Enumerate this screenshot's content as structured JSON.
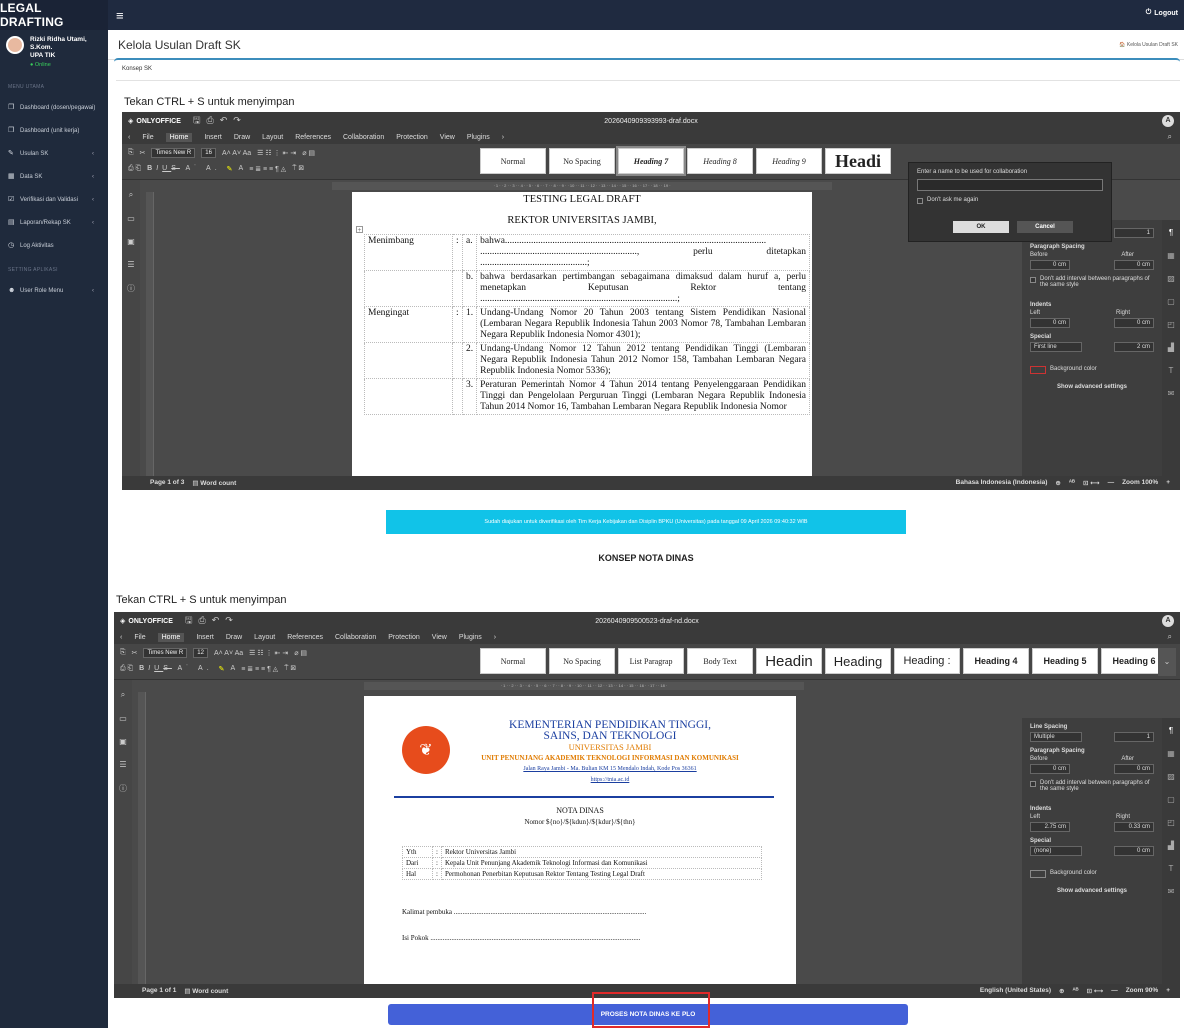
{
  "app": {
    "brand": "LEGAL DRAFTING",
    "logout": "Logout"
  },
  "user": {
    "name": "Rizki Ridha Utami, S.Kom.",
    "unit": "UPA TIK",
    "status": "Online"
  },
  "sidebar": {
    "menu_head": "MENU UTAMA",
    "settings_head": "SETTING APLIKASI",
    "items": [
      {
        "label": "Dashboard (dosen/pegawai)"
      },
      {
        "label": "Dashboard (unit kerja)"
      },
      {
        "label": "Usulan SK"
      },
      {
        "label": "Data SK"
      },
      {
        "label": "Verifikasi dan Validasi"
      },
      {
        "label": "Laporan/Rekap SK"
      },
      {
        "label": "Log Aktivitas"
      },
      {
        "label": "User Role Menu"
      }
    ]
  },
  "header": {
    "title": "Kelola Usulan Draft SK",
    "breadcrumb": "Kelola Usulan Draft SK",
    "tab": "Konsep SK"
  },
  "save_hint": "Tekan CTRL + S untuk menyimpan",
  "editor_common": {
    "brand": "ONLYOFFICE",
    "menus": [
      "File",
      "Home",
      "Insert",
      "Draw",
      "Layout",
      "References",
      "Collaboration",
      "Protection",
      "View",
      "Plugins"
    ],
    "font": "Times New R",
    "word_count": "Word count",
    "bg_color": "Background color",
    "advanced": "Show advanced settings",
    "para_spacing": "Paragraph Spacing",
    "before": "Before",
    "after": "After",
    "dont_add": "Don't add interval between paragraphs of the same style",
    "indents": "Indents",
    "left": "Left",
    "right": "Right",
    "special": "Special"
  },
  "editor1": {
    "filename": "2026040909393993-draf.docx",
    "font_size": "16",
    "styles": [
      "Normal",
      "No Spacing",
      "Heading 7",
      "Heading 8",
      "Heading 9",
      "Headi"
    ],
    "page_info": "Page 1 of 3",
    "language": "Bahasa Indonesia (Indonesia)",
    "zoom": "Zoom 100%",
    "spacing_before": "0 cm",
    "spacing_after": "0 cm",
    "indent_left": "0 cm",
    "indent_right": "0 cm",
    "special_val": "First line",
    "special_num": "2 cm",
    "line_val": "1",
    "doc": {
      "title": "TESTING LEGAL DRAFT",
      "subtitle": "REKTOR UNIVERSITAS JAMBI,",
      "menimbang": "Menimbang",
      "mengingat": "Mengingat",
      "a": "a.",
      "b": "b.",
      "n1": "1.",
      "n2": "2.",
      "n3": "3.",
      "colon": ":",
      "a_text": "bahwa.............................................................................................................. .................................................................., perlu ditetapkan .............................................;",
      "b_text": "bahwa berdasarkan pertimbangan sebagaimana dimaksud dalam huruf a, perlu menetapkan Keputusan Rektor tentang ...................................................................................;",
      "m1": "Undang-Undang Nomor 20 Tahun 2003 tentang Sistem Pendidikan Nasional (Lembaran Negara Republik Indonesia Tahun 2003 Nomor 78, Tambahan Lembaran Negara Republik Indonesia Nomor 4301);",
      "m2": "Undang-Undang Nomor 12 Tahun 2012 tentang Pendidikan Tinggi (Lembaran Negara Republik Indonesia Tahun 2012 Nomor 158, Tambahan Lembaran Negara Republik Indonesia Nomor 5336);",
      "m3": "Peraturan Pemerintah Nomor 4 Tahun 2014 tentang Penyelenggaraan Pendidikan Tinggi dan Pengelolaan Perguruan Tinggi (Lembaran Negara Republik Indonesia Tahun 2014 Nomor 16, Tambahan Lembaran Negara Republik Indonesia Nomor"
    },
    "dialog": {
      "prompt": "Enter a name to be used for collaboration",
      "dont_ask": "Don't ask me again",
      "ok": "OK",
      "cancel": "Cancel"
    }
  },
  "notice": "Sudah diajukan untuk diverifikasi oleh Tim Kerja Kebijakan dan Disiplin BPKU (Universitas) pada tanggal 09 April 2026 09:40:32 WIB",
  "konsep_nota": "KONSEP NOTA DINAS",
  "editor2": {
    "filename": "2026040909500523-draf-nd.docx",
    "font_size": "12",
    "styles": [
      "Normal",
      "No Spacing",
      "List Paragrap",
      "Body Text",
      "Headin",
      "Heading",
      "Heading :",
      "Heading 4",
      "Heading 5",
      "Heading 6"
    ],
    "page_info": "Page 1 of 1",
    "language": "English (United States)",
    "zoom": "Zoom 90%",
    "line_spacing": "Line Spacing",
    "line_mode": "Multiple",
    "line_val": "1",
    "spacing_before": "0 cm",
    "spacing_after": "0 cm",
    "indent_left": "2.75 cm",
    "indent_right": "0.33 cm",
    "special_val": "(none)",
    "special_num": "0 cm",
    "doc": {
      "kop1": "KEMENTERIAN PENDIDIKAN TINGGI,",
      "kop1b": "SAINS, DAN TEKNOLOGI",
      "kop2": "UNIVERSITAS JAMBI",
      "kop3": "UNIT PENUNJANG AKADEMIK TEKNOLOGI INFORMASI DAN KOMUNIKASI",
      "kop4": "Jalan Raya Jambi - Ma. Bulian KM 15 Mendalo Indah, Kode Pos 36361",
      "kop5": "https://tnia.ac.id",
      "nota": "NOTA DINAS",
      "nomor": "Nomor ${no}/${kdun}/${kdur}/${thn}",
      "rows": [
        {
          "k": "Yth",
          "v": "Rektor Universitas Jambi"
        },
        {
          "k": "Dari",
          "v": "Kepala Unit Penunjang Akademik Teknologi Informasi dan Komunikasi"
        },
        {
          "k": "Hal",
          "v": "Permohonan Penerbitan Keputusan Rektor Tentang Testing Legal Draft"
        }
      ],
      "kalimat": "Kalimat pembuka ..............................................................................................................",
      "isi": "Isi Pokok ........................................................................................................................"
    }
  },
  "proses_button": "PROSES NOTA DINAS KE PLO"
}
